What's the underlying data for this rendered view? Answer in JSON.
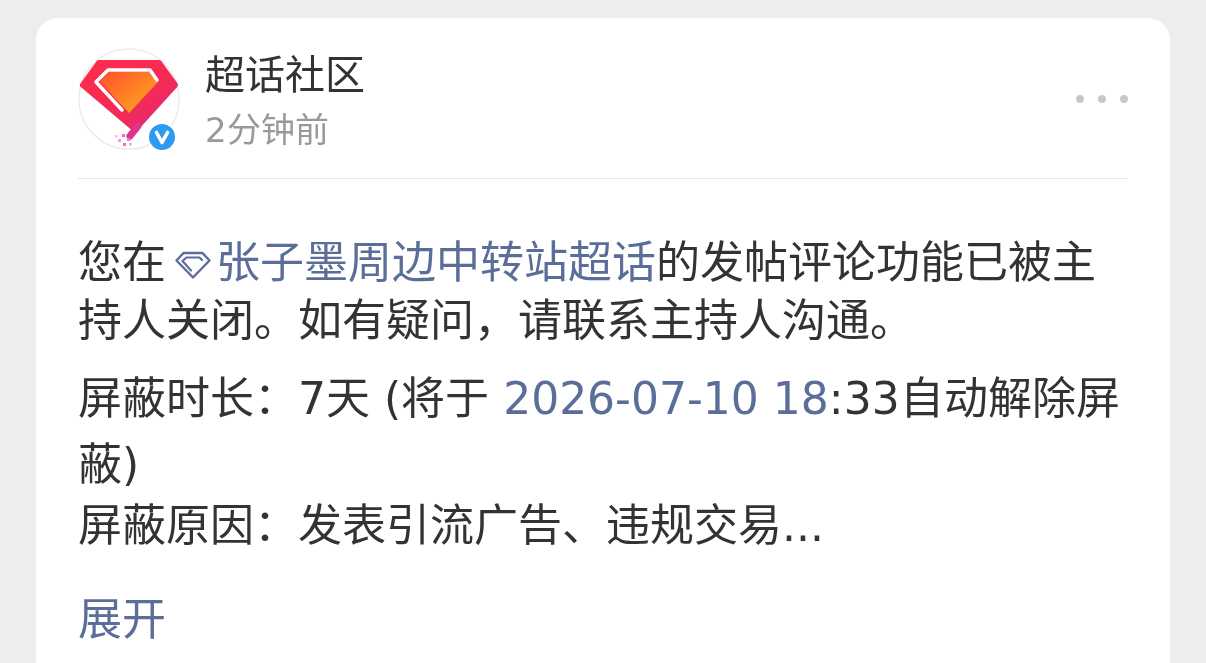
{
  "post": {
    "author": {
      "name": "超话社区",
      "verified": true
    },
    "time": "2分钟前",
    "paragraphs": [
      {
        "segments": [
          {
            "kind": "text",
            "text": "您在"
          },
          {
            "kind": "topic",
            "text": "张子墨周边中转站超话"
          },
          {
            "kind": "text",
            "text": "的发帖评论功能已被主持人关闭。如有疑问，请联系主持人沟通。"
          }
        ]
      },
      {
        "segments": [
          {
            "kind": "text",
            "text": "屏蔽时长：7天 (将于 "
          },
          {
            "kind": "link",
            "text": "2026-07-10 18"
          },
          {
            "kind": "text",
            "text": ":33自动解除屏蔽)"
          }
        ]
      },
      {
        "segments": [
          {
            "kind": "text",
            "text": "屏蔽原因：发表引流广告、违规交易..."
          }
        ]
      }
    ],
    "expand_link": "展开"
  }
}
